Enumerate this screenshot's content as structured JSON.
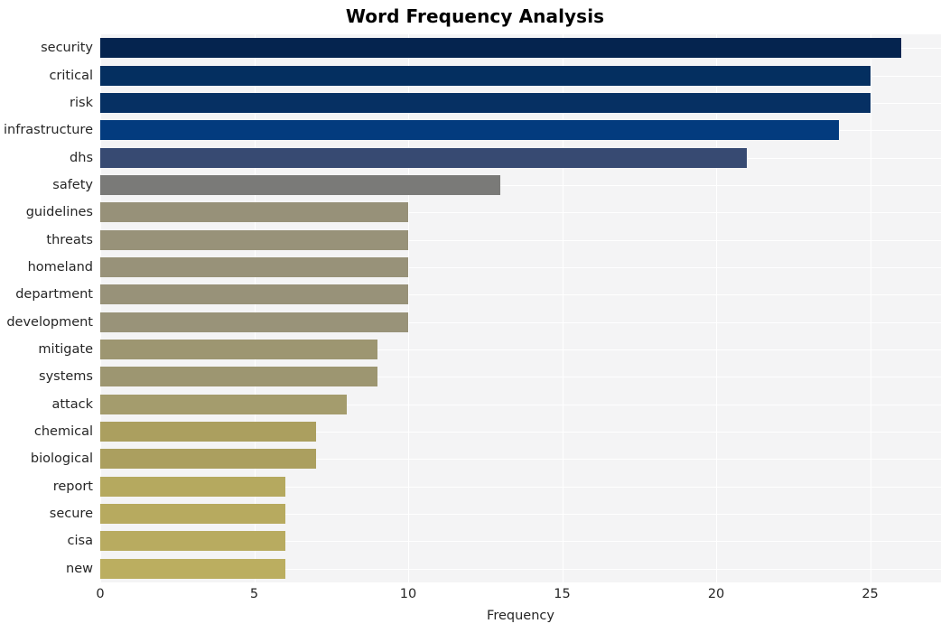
{
  "chart_data": {
    "type": "bar",
    "orientation": "horizontal",
    "title": "Word Frequency Analysis",
    "xlabel": "Frequency",
    "ylabel": "",
    "xlim": [
      0,
      27.3
    ],
    "xticks": [
      0,
      5,
      10,
      15,
      20,
      25
    ],
    "xtick_labels": [
      "0",
      "5",
      "10",
      "15",
      "20",
      "25"
    ],
    "grid": true,
    "legend": false,
    "categories": [
      "security",
      "critical",
      "risk",
      "infrastructure",
      "dhs",
      "safety",
      "guidelines",
      "threats",
      "homeland",
      "department",
      "development",
      "mitigate",
      "systems",
      "attack",
      "chemical",
      "biological",
      "report",
      "secure",
      "cisa",
      "new"
    ],
    "values": [
      26,
      25,
      25,
      24,
      21,
      13,
      10,
      10,
      10,
      10,
      10,
      9,
      9,
      8,
      7,
      7,
      6,
      6,
      6,
      6
    ],
    "bar_colors": [
      "#05244f",
      "#042f60",
      "#063063",
      "#033b7e",
      "#374a72",
      "#7a7a78",
      "#979179",
      "#989279",
      "#989279",
      "#989279",
      "#999379",
      "#9d9671",
      "#9d9671",
      "#a49c6d",
      "#ab9f5f",
      "#ab9f5f",
      "#b5a95f",
      "#b7aa5f",
      "#b8ab60",
      "#bbae60"
    ],
    "plot_background": "#f4f4f5",
    "gridline_color": "#ffffff"
  }
}
